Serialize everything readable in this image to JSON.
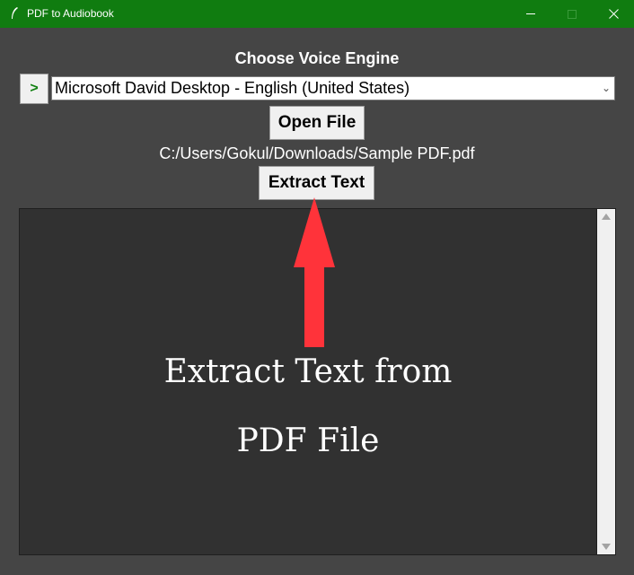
{
  "window": {
    "title": "PDF to Audiobook",
    "accent_color": "#107c10"
  },
  "main": {
    "heading": "Choose Voice Engine",
    "arrow_button_label": ">",
    "voice_select_value": "Microsoft David Desktop - English (United States)",
    "open_file_label": "Open File",
    "file_path": "C:/Users/Gokul/Downloads/Sample PDF.pdf",
    "extract_text_label": "Extract Text"
  },
  "annotation": {
    "line1": "Extract Text from",
    "line2": "PDF File",
    "arrow_color": "#ff333a"
  }
}
